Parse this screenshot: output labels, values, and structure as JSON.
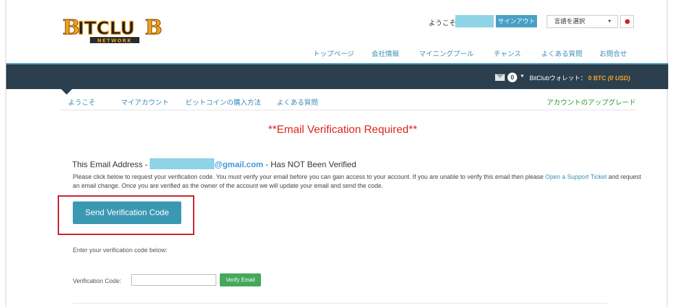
{
  "header": {
    "logo_text": "BITCLUB",
    "logo_sub": "NETWORK",
    "welcome": "ようこそ:",
    "signout": "サインアウト",
    "language_select": "言語を選択",
    "flag_icon": "japan-flag-icon"
  },
  "top_nav": [
    "トップページ",
    "会社情報",
    "マイニングプール",
    "チャンス",
    "よくある質問",
    "お問合せ"
  ],
  "account_bar": {
    "mail_icon": "envelope-icon",
    "message_count": "0",
    "wallet_label": "BitClubウォレット：",
    "wallet_btc": "0 BTC",
    "wallet_usd": "(0 USD)"
  },
  "sub_nav": [
    "ようこそ",
    "マイアカウント",
    "ビットコインの購入方法",
    "よくある質問"
  ],
  "upgrade_link": "アカウントのアップグレード",
  "main": {
    "title": "**Email Verification Required**",
    "email_prefix": "This Email Address -",
    "email_domain": "@gmail.com",
    "email_suffix": "- Has NOT Been Verified",
    "desc_1": "Please click below to request your verification code. You must verify your email before you can gain access to your account. If you are unable to verify this email then please",
    "desc_link": "Open a Support Ticket",
    "desc_2": "and request an email change. Once you are verified as the owner of the account we will update your email and send the code.",
    "send_button": "Send Verification Code",
    "enter_label": "Enter your verification code below:",
    "code_label": "Verification Code:",
    "code_value": "",
    "verify_button": "Verify Email"
  },
  "colors": {
    "dark_bar": "#2c3f4f",
    "title_red": "#d9241f",
    "send_button": "#3b98b3",
    "verify_button": "#45a85a",
    "highlight_border": "#c8202d"
  }
}
